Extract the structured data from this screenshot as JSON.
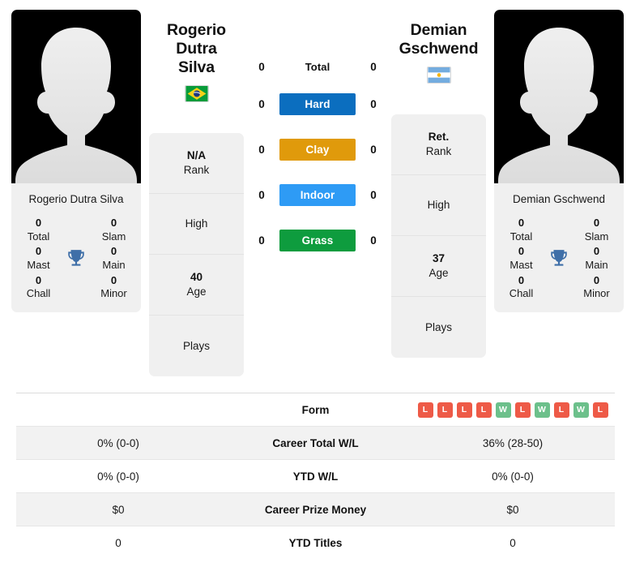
{
  "players": {
    "left": {
      "name_line1": "Rogerio Dutra",
      "name_line2": "Silva",
      "photo_caption": "Rogerio Dutra Silva",
      "country": "Brazil",
      "flag_icon": "brazil-flag-icon",
      "titles": {
        "total": "0",
        "total_label": "Total",
        "slam": "0",
        "slam_label": "Slam",
        "mast": "0",
        "mast_label": "Mast",
        "main": "0",
        "main_label": "Main",
        "chall": "0",
        "chall_label": "Chall",
        "minor": "0",
        "minor_label": "Minor"
      },
      "info": {
        "rank_value": "N/A",
        "rank_label": "Rank",
        "high_label": "High",
        "age_value": "40",
        "age_label": "Age",
        "plays_label": "Plays"
      },
      "surfaces": {
        "total": "0",
        "hard": "0",
        "clay": "0",
        "indoor": "0",
        "grass": "0"
      }
    },
    "right": {
      "name_line1": "Demian",
      "name_line2": "Gschwend",
      "photo_caption": "Demian Gschwend",
      "country": "Argentina",
      "flag_icon": "argentina-flag-icon",
      "titles": {
        "total": "0",
        "total_label": "Total",
        "slam": "0",
        "slam_label": "Slam",
        "mast": "0",
        "mast_label": "Mast",
        "main": "0",
        "main_label": "Main",
        "chall": "0",
        "chall_label": "Chall",
        "minor": "0",
        "minor_label": "Minor"
      },
      "info": {
        "rank_value": "Ret.",
        "rank_label": "Rank",
        "high_label": "High",
        "age_value": "37",
        "age_label": "Age",
        "plays_label": "Plays"
      },
      "surfaces": {
        "total": "0",
        "hard": "0",
        "clay": "0",
        "indoor": "0",
        "grass": "0"
      }
    }
  },
  "surface_labels": {
    "total": "Total",
    "hard": "Hard",
    "clay": "Clay",
    "indoor": "Indoor",
    "grass": "Grass"
  },
  "colors": {
    "hard": "#0b6ebf",
    "clay": "#e09a0b",
    "indoor": "#2e9bf5",
    "grass": "#0e9c3e",
    "win": "#6cc08b",
    "loss": "#ee5a47",
    "trophy": "#3f6fa8",
    "panel": "#f0f0f0",
    "stripe": "#f2f2f2"
  },
  "icons": {
    "trophy": "trophy-icon"
  },
  "stats_table": {
    "rows": [
      {
        "label": "Form",
        "type": "form",
        "left_form": [],
        "right_form": [
          "L",
          "L",
          "L",
          "L",
          "W",
          "L",
          "W",
          "L",
          "W",
          "L"
        ],
        "left": "",
        "right": ""
      },
      {
        "label": "Career Total W/L",
        "type": "text",
        "left": "0% (0-0)",
        "right": "36% (28-50)"
      },
      {
        "label": "YTD W/L",
        "type": "text",
        "left": "0% (0-0)",
        "right": "0% (0-0)"
      },
      {
        "label": "Career Prize Money",
        "type": "text",
        "left": "$0",
        "right": "$0"
      },
      {
        "label": "YTD Titles",
        "type": "text",
        "left": "0",
        "right": "0"
      }
    ]
  }
}
